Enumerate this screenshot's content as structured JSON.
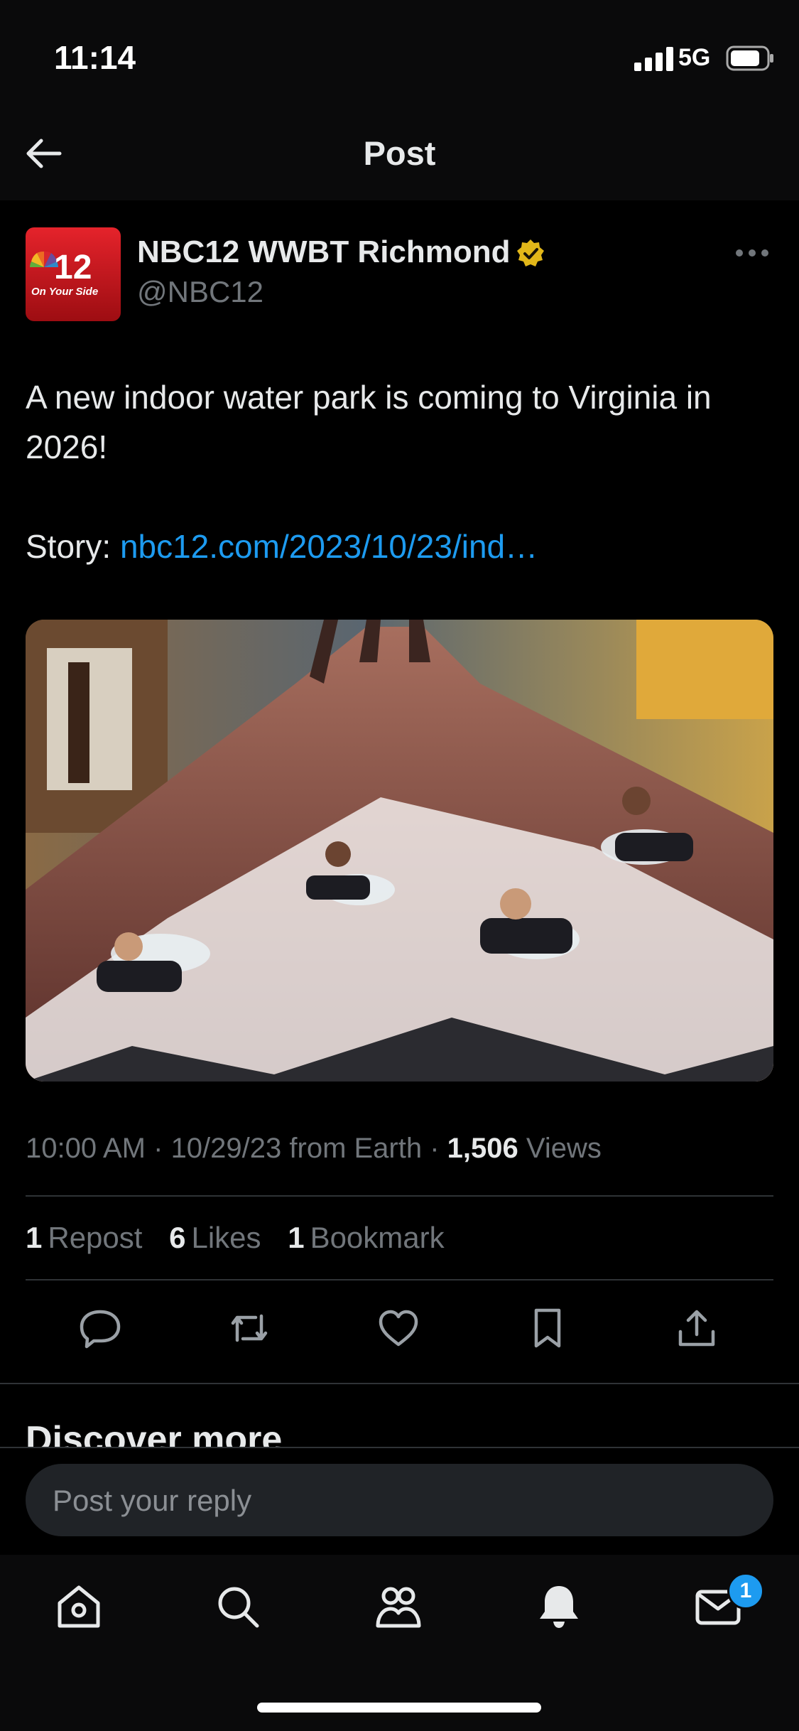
{
  "status_bar": {
    "time": "11:14",
    "network": "5G"
  },
  "nav": {
    "title": "Post"
  },
  "post": {
    "author_name": "NBC12 WWBT Richmond",
    "handle": "@NBC12",
    "avatar_logo_text": "12",
    "avatar_tagline": "On Your Side",
    "text_line1": "A new indoor water park is coming to Virginia in 2026!",
    "story_label": "Story:",
    "story_link": "nbc12.com/2023/10/23/ind…",
    "time": "10:00 AM",
    "date": "10/29/23",
    "source": "from Earth",
    "views_count": "1,506",
    "views_label": "Views",
    "reposts_count": "1",
    "reposts_label": "Repost",
    "likes_count": "6",
    "likes_label": "Likes",
    "bookmarks_count": "1",
    "bookmarks_label": "Bookmark"
  },
  "discover_heading": "Discover more",
  "reply": {
    "placeholder": "Post your reply"
  },
  "tabs": {
    "messages_badge": "1"
  },
  "icons": [
    "back-arrow-icon",
    "verified-badge-icon",
    "more-icon",
    "reply-icon",
    "repost-icon",
    "like-icon",
    "bookmark-icon",
    "share-icon",
    "home-icon",
    "search-icon",
    "communities-icon",
    "notifications-icon",
    "messages-icon"
  ],
  "colors": {
    "accent": "#1d9bf0",
    "verified": "#e2b719",
    "background": "#000000"
  }
}
